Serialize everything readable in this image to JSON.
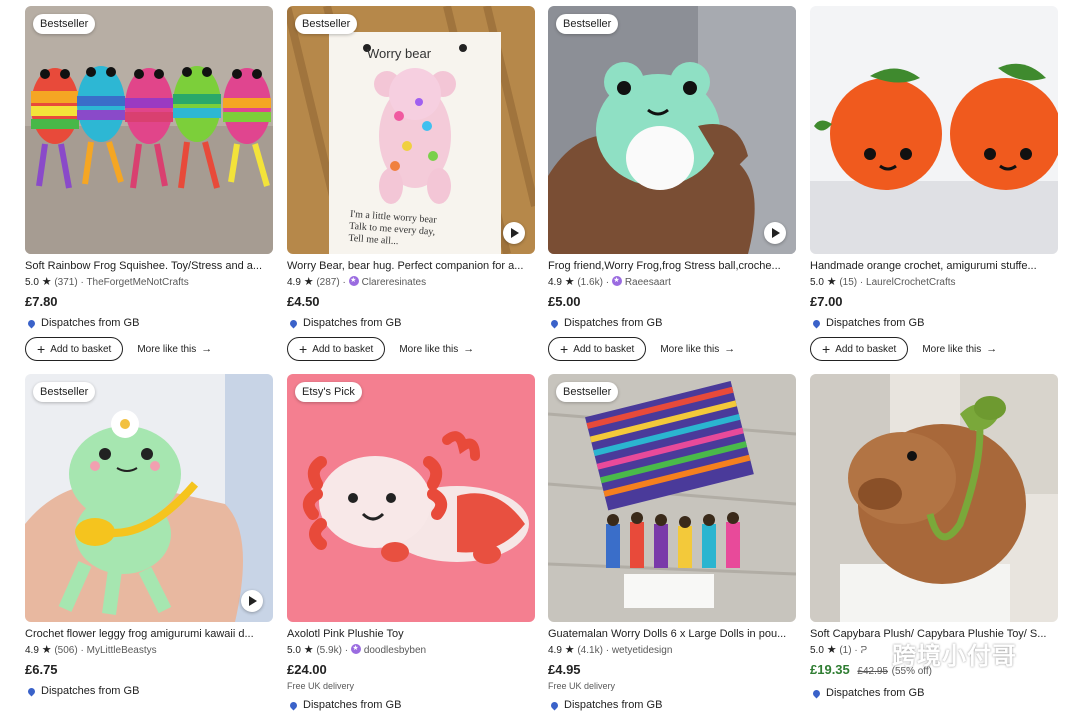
{
  "products": [
    {
      "badge": "Bestseller",
      "title": "Soft Rainbow Frog Squishee. Toy/Stress and a...",
      "rating": "5.0",
      "reviews": "(371)",
      "shop": "TheForgetMeNotCrafts",
      "star_seller": false,
      "price": "£7.80",
      "dispatch": "Dispatches from GB",
      "add_label": "Add to basket",
      "more_label": "More like this",
      "video": false
    },
    {
      "badge": "Bestseller",
      "title": "Worry Bear, bear hug. Perfect companion for a...",
      "rating": "4.9",
      "reviews": "(287)",
      "shop": "Clareresinates",
      "star_seller": true,
      "price": "£4.50",
      "dispatch": "Dispatches from GB",
      "add_label": "Add to basket",
      "more_label": "More like this",
      "video": true,
      "card_text_top": "Worry bear",
      "card_text_bottom": "I'm a little worry bear\nTalk to me every day,\nTell me all..."
    },
    {
      "badge": "Bestseller",
      "title": "Frog friend,Worry Frog,frog Stress ball,croche...",
      "rating": "4.9",
      "reviews": "(1.6k)",
      "shop": "Raeesaart",
      "star_seller": true,
      "price": "£5.00",
      "dispatch": "Dispatches from GB",
      "add_label": "Add to basket",
      "more_label": "More like this",
      "video": true
    },
    {
      "badge": "",
      "title": "Handmade orange crochet, amigurumi stuffe...",
      "rating": "5.0",
      "reviews": "(15)",
      "shop": "LaurelCrochetCrafts",
      "star_seller": false,
      "price": "£7.00",
      "dispatch": "Dispatches from GB",
      "add_label": "Add to basket",
      "more_label": "More like this",
      "video": false
    },
    {
      "badge": "Bestseller",
      "title": "Crochet flower leggy frog amigurumi kawaii d...",
      "rating": "4.9",
      "reviews": "(506)",
      "shop": "MyLittleBeastys",
      "star_seller": false,
      "price": "£6.75",
      "dispatch": "Dispatches from GB",
      "video": true
    },
    {
      "badge": "Etsy's Pick",
      "title": "Axolotl Pink Plushie Toy",
      "rating": "5.0",
      "reviews": "(5.9k)",
      "shop": "doodlesbyben",
      "star_seller": true,
      "price": "£24.00",
      "delivery": "Free UK delivery",
      "dispatch": "Dispatches from GB",
      "video": false
    },
    {
      "badge": "Bestseller",
      "title": "Guatemalan Worry Dolls 6 x Large Dolls in pou...",
      "rating": "4.9",
      "reviews": "(4.1k)",
      "shop": "wetyetidesign",
      "star_seller": false,
      "price": "£4.95",
      "delivery": "Free UK delivery",
      "dispatch": "Dispatches from GB",
      "video": false
    },
    {
      "badge": "",
      "title": "Soft Capybara Plush/ Capybara Plushie Toy/ S...",
      "rating": "5.0",
      "reviews": "(1)",
      "shop": "P",
      "star_seller": false,
      "price": "£19.35",
      "old_price": "£42.95",
      "pct": "(55% off)",
      "dispatch": "Dispatches from GB",
      "video": false
    }
  ],
  "watermark": "跨境小付哥",
  "colors": {
    "accent": "#222222",
    "sale": "#2f7d32",
    "pin": "#3a62c9",
    "star_seller": "#9a6be0"
  }
}
